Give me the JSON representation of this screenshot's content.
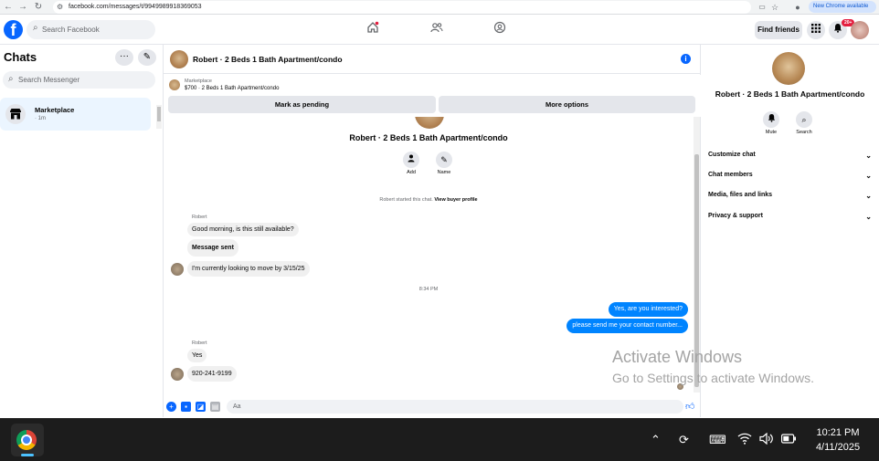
{
  "browser": {
    "url": "facebook.com/messages/t/9949989918369053",
    "chrome_available": "New Chrome available"
  },
  "header": {
    "search_placeholder": "Search Facebook",
    "find_friends": "Find friends",
    "notif_count": "20+"
  },
  "sidebar": {
    "title": "Chats",
    "search_placeholder": "Search Messenger",
    "chats": [
      {
        "name": "Marketplace",
        "time": "· 1m"
      }
    ]
  },
  "conversation": {
    "title": "Robert · 2 Beds 1 Bath Apartment/condo",
    "marketplace_label": "Marketplace",
    "listing": "$700 · 2 Beds 1 Bath Apartment/condo",
    "mark_pending": "Mark as pending",
    "more_options": "More options",
    "profile_name": "Robert · 2 Beds 1 Bath Apartment/condo",
    "actions": [
      {
        "label": "Add",
        "icon": "add-person-icon"
      },
      {
        "label": "Name",
        "icon": "pencil-icon"
      }
    ],
    "started_text": "Robert started this chat.",
    "view_profile": "View buyer profile",
    "messages": {
      "sender1": "Robert",
      "m1": "Good morning, is this still available?",
      "m2": "Message sent",
      "m3": "I'm currently looking to move by 3/15/25",
      "timestamp": "8:34 PM",
      "out1": "Yes, are you interested?",
      "out2": "please send me your contact number...",
      "sender2": "Robert",
      "m4": "Yes",
      "m5": "920-241-9199"
    },
    "composer_placeholder": "Aa"
  },
  "details": {
    "name": "Robert · 2 Beds 1 Bath Apartment/condo",
    "mute": "Mute",
    "search": "Search",
    "sections": [
      "Customize chat",
      "Chat members",
      "Media, files and links",
      "Privacy & support"
    ]
  },
  "watermark": {
    "line1": "Activate Windows",
    "line2": "Go to Settings to activate Windows."
  },
  "taskbar": {
    "time": "10:21 PM",
    "date": "4/11/2025"
  },
  "colors": {
    "accent": "#0866ff",
    "bubble_out": "#0084ff",
    "badge": "#e41e3f"
  }
}
